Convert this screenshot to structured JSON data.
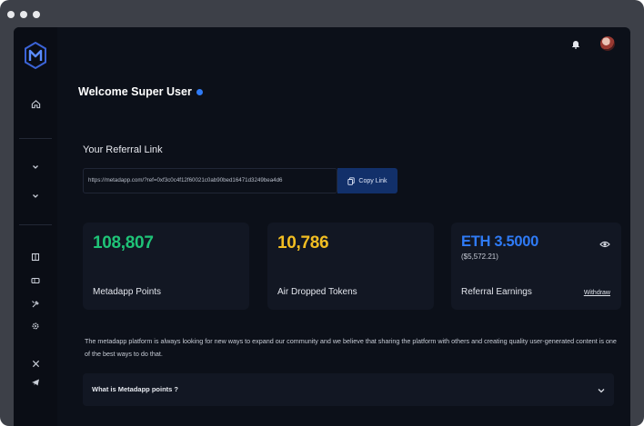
{
  "window": {
    "controls": [
      "close",
      "minimize",
      "maximize"
    ]
  },
  "sidebar": {
    "icons": [
      "logo",
      "home-icon",
      "chevron-down-icon",
      "chevron-down-icon",
      "book-icon",
      "ticket-icon",
      "tool-icon",
      "gear-icon",
      "x-twitter-icon",
      "telegram-icon"
    ]
  },
  "topbar": {
    "icons": [
      "bell-icon",
      "avatar"
    ]
  },
  "welcome": {
    "title": "Welcome Super User"
  },
  "referral": {
    "label": "Your Referral Link",
    "link": "https://metadapp.com/?ref=0xf3c0c4f12f60021c0ab90bed16471d3249bea4d6",
    "copy_label": "Copy Link"
  },
  "cards": {
    "points": {
      "value": "108,807",
      "label": "Metadapp Points",
      "color": "#1fc377"
    },
    "tokens": {
      "value": "10,786",
      "label": "Air Dropped Tokens",
      "color": "#f2be22"
    },
    "earnings": {
      "value": "ETH 3.5000",
      "usd": "($5,572.21)",
      "label": "Referral Earnings",
      "withdraw": "Withdraw",
      "color": "#2f7bf6"
    }
  },
  "description": "The metadapp platform is always looking for new ways to expand our community and we believe that  sharing the platform with others and creating quality user-generated content is one of the best ways to do that.",
  "faq": {
    "question": "What is Metadapp points ?"
  },
  "colors": {
    "background": "#0c1019",
    "card": "#121723",
    "accent": "#2f7bf6",
    "button": "#12306a"
  }
}
